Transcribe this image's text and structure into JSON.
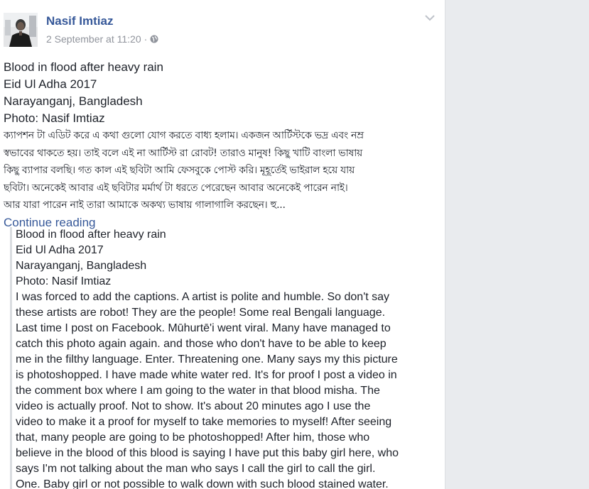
{
  "post": {
    "author": "Nasif Imtiaz",
    "date": "2 September at 11:20",
    "separator": "·",
    "lines": [
      "Blood in flood after heavy rain",
      "Eid Ul Adha 2017",
      "Narayanganj, Bangladesh",
      "Photo: Nasif Imtiaz"
    ],
    "bengali_lines": [
      "ক্যাপশন টা এডিট করে এ কথা গুলো যোগ করতে বাধ্য হলাম। একজন আর্টিস্টকে ভদ্র এবং নম্র",
      "স্বভাবের থাকতে হয়। তাই বলে এই না আর্টিস্ট রা রোবট! তারাও মানুষ! কিছু খাটি বাংলা ভাষায়",
      "কিছু ব্যাপার বলছি। গত কাল এই ছবিটা আমি ফেসবুকে পোস্ট করি। মূহূর্তেই ভাইরাল হয়ে যায়",
      "ছবিটা। অনেকেই আবার এই ছবিটার মর্মার্থ টা ধরতে পেরেছেন আবার অনেকেই পারেন নাই।",
      "আর যারা পারেন নাই তারা আমাকে অকথ্য ভাষায় গালাগালি করছেন। হু..."
    ],
    "continue_label": "Continue reading"
  },
  "translation": {
    "lines": [
      "Blood in flood after heavy rain",
      "Eid Ul Adha 2017",
      "Narayanganj, Bangladesh",
      "Photo: Nasif Imtiaz",
      "I was forced to add the captions. A artist is polite and humble. So don't say",
      "these artists are robot! They are the people! Some real Bengali language.",
      "Last time I post on Facebook. Mūhurtē'i went viral. Many have managed to",
      "catch this photo again again. and those who don't have to be able to keep",
      "me in the filthy language. Enter. Threatening one. Many says my this picture",
      "is photoshopped. I have made white water red. It's for proof I post a video in",
      "the comment box where I am going to the water in that blood misha. The",
      "video is actually proof. Not to show. It's about 20 minutes ago I use the",
      "video to make it a proof for myself to take memories to myself! After seeing",
      "that, many people are going to be photoshopped! After him, those who",
      "believe in the blood of this blood is saying I have put this baby girl here, who",
      "says I'm not talking about the man who says I call the girl to call the girl.",
      "One. Baby girl or not possible to walk down with such blood stained water."
    ]
  },
  "icons": {
    "globe": "globe-icon",
    "chevron": "chevron-down-icon",
    "avatar": "avatar"
  },
  "colors": {
    "link": "#365899",
    "meta": "#90949c",
    "text": "#1d2129",
    "background": "#e9ebee"
  }
}
